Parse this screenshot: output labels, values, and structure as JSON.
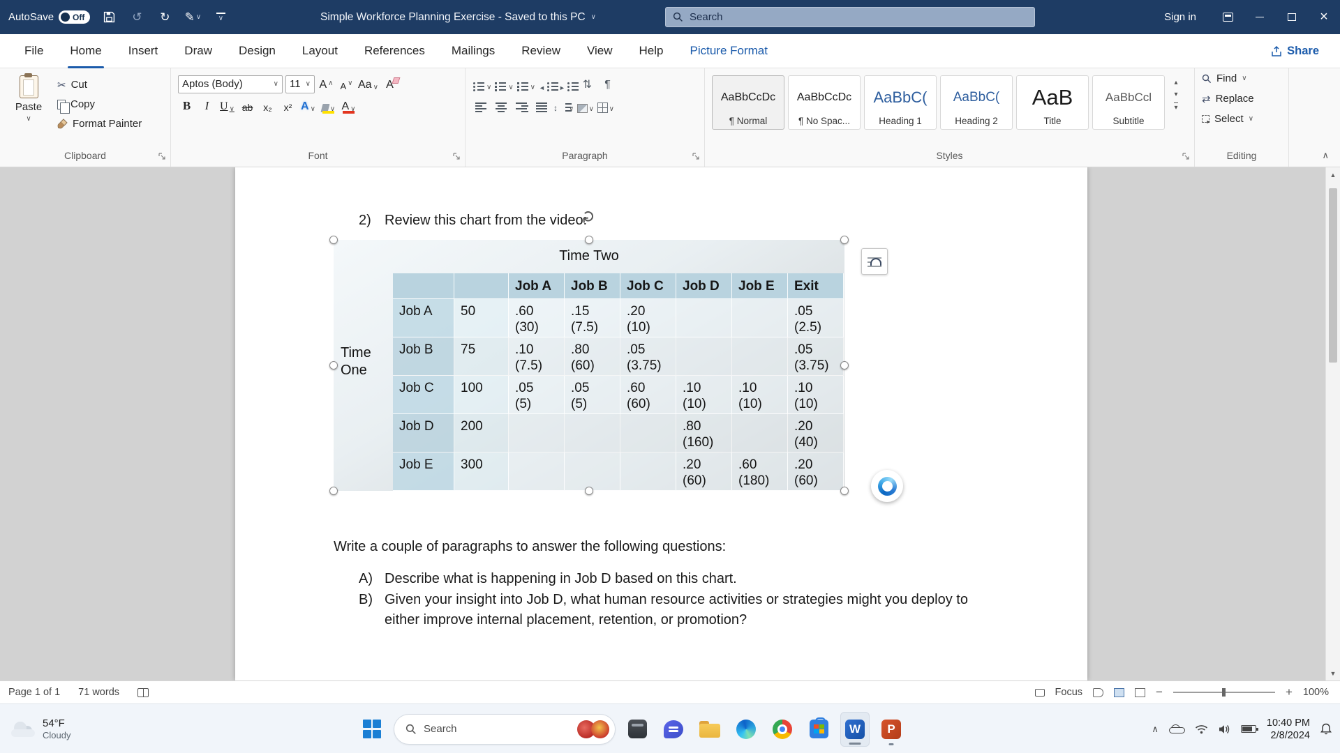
{
  "titlebar": {
    "autosave_label": "AutoSave",
    "autosave_state": "Off",
    "doc_title": "Simple Workforce Planning Exercise - Saved to this PC",
    "search_text": "Search",
    "sign_in": "Sign in"
  },
  "tabs": {
    "items": [
      {
        "label": "File"
      },
      {
        "label": "Home"
      },
      {
        "label": "Insert"
      },
      {
        "label": "Draw"
      },
      {
        "label": "Design"
      },
      {
        "label": "Layout"
      },
      {
        "label": "References"
      },
      {
        "label": "Mailings"
      },
      {
        "label": "Review"
      },
      {
        "label": "View"
      },
      {
        "label": "Help"
      },
      {
        "label": "Picture Format"
      }
    ],
    "share": "Share"
  },
  "ribbon": {
    "clipboard": {
      "label": "Clipboard",
      "paste": "Paste",
      "cut": "Cut",
      "copy": "Copy",
      "format_painter": "Format Painter"
    },
    "font": {
      "label": "Font",
      "name": "Aptos (Body)",
      "size": "11"
    },
    "paragraph": {
      "label": "Paragraph"
    },
    "styles": {
      "label": "Styles",
      "items": [
        {
          "preview": "AaBbCcDc",
          "name": "¶ Normal"
        },
        {
          "preview": "AaBbCcDc",
          "name": "¶ No Spac..."
        },
        {
          "preview": "AaBbC(",
          "name": "Heading 1"
        },
        {
          "preview": "AaBbC(",
          "name": "Heading 2"
        },
        {
          "preview": "AaB",
          "name": "Title"
        },
        {
          "preview": "AaBbCcl",
          "name": "Subtitle"
        }
      ]
    },
    "editing": {
      "label": "Editing",
      "find": "Find",
      "replace": "Replace",
      "select": "Select"
    }
  },
  "document": {
    "item_number": "2)",
    "item_text": "Review this chart from the video:",
    "prompt": "Write a couple of paragraphs to answer the following questions:",
    "qa_label": "A)",
    "qa_text": "Describe what is happening in Job D based on this chart.",
    "qb_label": "B)",
    "qb_text": "Given your insight into Job D, what human resource activities or strategies might you deploy to either improve internal placement, retention, or promotion?"
  },
  "chart_data": {
    "type": "table",
    "title": "Time Two",
    "row_axis_label_line1": "Time",
    "row_axis_label_line2": "One",
    "columns": [
      "Job A",
      "Job B",
      "Job C",
      "Job D",
      "Job E",
      "Exit"
    ],
    "rows": [
      {
        "label": "Job A",
        "count": "50",
        "cells": [
          [
            ".60",
            "(30)"
          ],
          [
            ".15",
            "(7.5)"
          ],
          [
            ".20",
            "(10)"
          ],
          null,
          null,
          [
            ".05",
            "(2.5)"
          ]
        ]
      },
      {
        "label": "Job B",
        "count": "75",
        "cells": [
          [
            ".10",
            "(7.5)"
          ],
          [
            ".80",
            "(60)"
          ],
          [
            ".05",
            "(3.75)"
          ],
          null,
          null,
          [
            ".05",
            "(3.75)"
          ]
        ]
      },
      {
        "label": "Job C",
        "count": "100",
        "cells": [
          [
            ".05",
            "(5)"
          ],
          [
            ".05",
            "(5)"
          ],
          [
            ".60",
            "(60)"
          ],
          [
            ".10",
            "(10)"
          ],
          [
            ".10",
            "(10)"
          ],
          [
            ".10",
            "(10)"
          ]
        ]
      },
      {
        "label": "Job D",
        "count": "200",
        "cells": [
          null,
          null,
          null,
          [
            ".80",
            "(160)"
          ],
          null,
          [
            ".20",
            "(40)"
          ]
        ]
      },
      {
        "label": "Job E",
        "count": "300",
        "cells": [
          null,
          null,
          null,
          [
            ".20",
            "(60)"
          ],
          [
            ".60",
            "(180)"
          ],
          [
            ".20",
            "(60)"
          ]
        ]
      }
    ]
  },
  "statusbar": {
    "page": "Page 1 of 1",
    "words": "71 words",
    "focus_label": "Focus",
    "zoom_level": "100%"
  },
  "taskbar": {
    "weather_temp": "54°F",
    "weather_condition": "Cloudy",
    "search_label": "Search",
    "clock_time": "10:40 PM",
    "clock_date": "2/8/2024"
  },
  "glyphs": {
    "chevron_down": "∨",
    "chevron_up": "∧",
    "tri_up": "▴",
    "tri_down": "▾",
    "scroll_up": "▲",
    "scroll_down": "▼",
    "undo": "↺",
    "redo": "↻",
    "cut_scissors": "✂",
    "pen": "✎",
    "bold": "B",
    "italic": "I",
    "underline": "U",
    "strike": "ab",
    "subscript": "x₂",
    "superscript": "x²",
    "letter_a": "A",
    "change_case": "Aa",
    "pilcrow": "¶",
    "sort": "⇅",
    "updown": "↕",
    "outdent": "◄",
    "indent": "►",
    "replace": "⇄",
    "close": "×"
  }
}
